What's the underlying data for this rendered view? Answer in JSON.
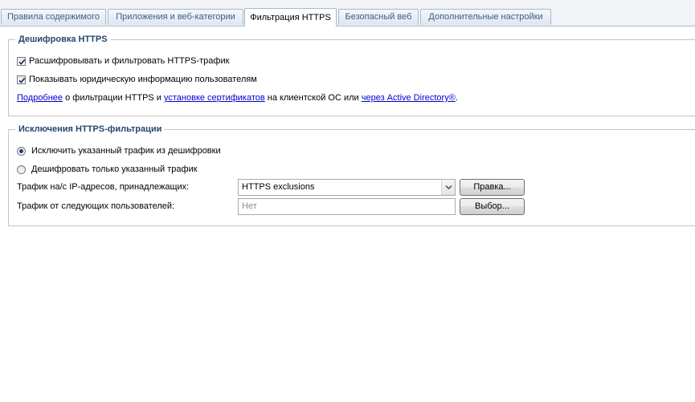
{
  "tabs": [
    {
      "label": "Правила содержимого",
      "active": false
    },
    {
      "label": "Приложения и веб-категории",
      "active": false
    },
    {
      "label": "Фильтрация HTTPS",
      "active": true
    },
    {
      "label": "Безопасный веб",
      "active": false
    },
    {
      "label": "Дополнительные настройки",
      "active": false
    }
  ],
  "decryption": {
    "title": "Дешифровка HTTPS",
    "decrypt_filter": {
      "label": "Расшифровывать и фильтровать HTTPS-трафик",
      "checked": true
    },
    "show_legal": {
      "label": "Показывать юридическую информацию пользователям",
      "checked": true
    },
    "info": {
      "link1": "Подробнее",
      "text1": " о фильтрации HTTPS и ",
      "link2": "установке сертификатов",
      "text2": " на клиентской ОС или ",
      "link3": "через Active Directory®",
      "text3": "."
    }
  },
  "exclusions": {
    "title": "Исключения HTTPS-фильтрации",
    "radio_exclude": {
      "label": "Исключить указанный трафик из дешифровки",
      "checked": true
    },
    "radio_only": {
      "label": "Дешифровать только указанный трафик",
      "checked": false
    },
    "ip_label": "Трафик на/с IP-адресов, принадлежащих:",
    "ip_value": "HTTPS exclusions",
    "edit_button": "Правка...",
    "users_label": "Трафик от следующих пользователей:",
    "users_placeholder": "Нет",
    "select_button": "Выбор..."
  },
  "colors": {
    "group_title": "#25466d",
    "link": "#0000cc",
    "tab_text": "#3b5d86"
  }
}
